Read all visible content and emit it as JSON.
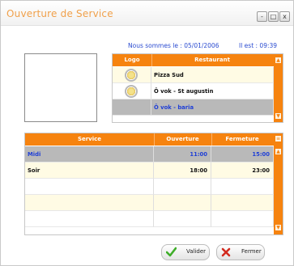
{
  "window": {
    "title": "Ouverture de Service",
    "minimize": "-",
    "maximize": "□",
    "close": "x"
  },
  "header": {
    "date_text": "Nous sommes le : 05/01/2006",
    "time_text": "Il est : 09:39"
  },
  "restaurants": {
    "columns": [
      "Logo",
      "Restaurant"
    ],
    "rows": [
      {
        "name": "Pizza Sud",
        "selected": false
      },
      {
        "name": "Ô vok - St augustin",
        "selected": false
      },
      {
        "name": "Ô vok - baria",
        "selected": true
      }
    ]
  },
  "services": {
    "columns": [
      "Service",
      "Ouverture",
      "Fermeture"
    ],
    "rows": [
      {
        "service": "Midi",
        "open": "11:00",
        "close": "15:00",
        "selected": true
      },
      {
        "service": "Soir",
        "open": "18:00",
        "close": "23:00",
        "selected": false
      }
    ]
  },
  "buttons": {
    "validate": "Valider",
    "close": "Fermer"
  },
  "colors": {
    "accent": "#f6830f",
    "title": "#f0a04a",
    "selection_text": "#1f3fd6"
  }
}
